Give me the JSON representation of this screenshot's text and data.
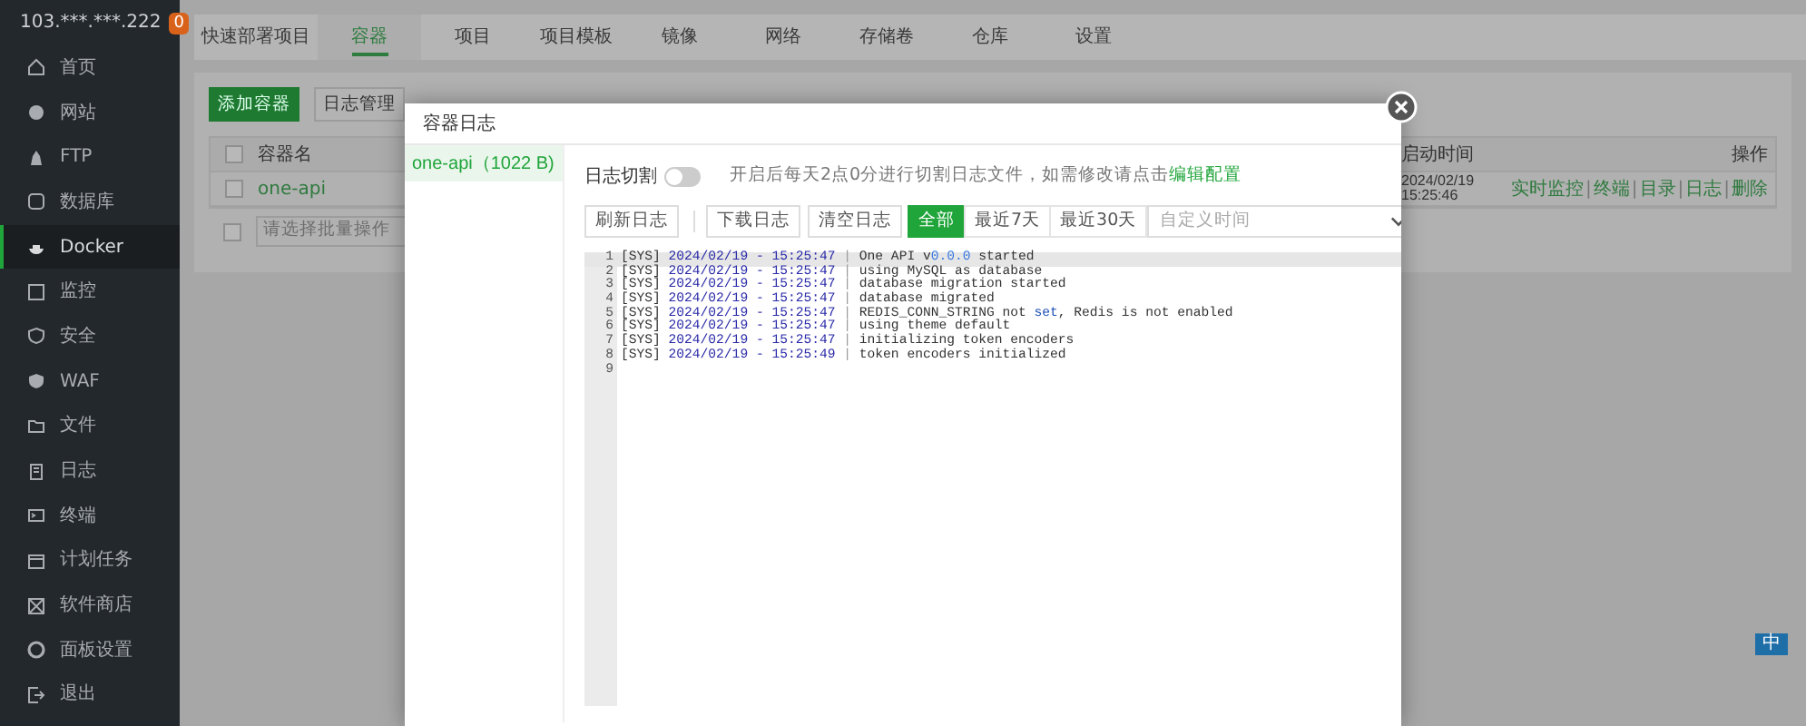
{
  "server": {
    "address": "103.***.***.222",
    "badge": "0"
  },
  "sidebar": {
    "items": [
      {
        "label": "首页",
        "selected": false
      },
      {
        "label": "网站",
        "selected": false
      },
      {
        "label": "FTP",
        "selected": false
      },
      {
        "label": "数据库",
        "selected": false
      },
      {
        "label": "Docker",
        "selected": true
      },
      {
        "label": "监控",
        "selected": false
      },
      {
        "label": "安全",
        "selected": false
      },
      {
        "label": "WAF",
        "selected": false
      },
      {
        "label": "文件",
        "selected": false
      },
      {
        "label": "日志",
        "selected": false
      },
      {
        "label": "终端",
        "selected": false
      },
      {
        "label": "计划任务",
        "selected": false
      },
      {
        "label": "软件商店",
        "selected": false
      },
      {
        "label": "面板设置",
        "selected": false
      },
      {
        "label": "退出",
        "selected": false
      }
    ]
  },
  "tabs": [
    {
      "label": "快速部署项目",
      "selected": false
    },
    {
      "label": "容器",
      "selected": true
    },
    {
      "label": "项目",
      "selected": false
    },
    {
      "label": "项目模板",
      "selected": false
    },
    {
      "label": "镜像",
      "selected": false
    },
    {
      "label": "网络",
      "selected": false
    },
    {
      "label": "存储卷",
      "selected": false
    },
    {
      "label": "仓库",
      "selected": false
    },
    {
      "label": "设置",
      "selected": false
    }
  ],
  "toolbar": {
    "buttons": [
      {
        "label": "添加容器",
        "kind": "primary"
      },
      {
        "label": "日志管理",
        "kind": "default"
      }
    ]
  },
  "table": {
    "header": {
      "select_all_checked": false,
      "name": "容器名",
      "start_time": "启动时间",
      "actions": "操作"
    },
    "rows": [
      {
        "checked": false,
        "name": "one-api",
        "start_time": "2024/02/19 15:25:46",
        "actions": [
          "实时监控",
          "终端",
          "目录",
          "日志",
          "删除"
        ],
        "separators": [
          "|",
          "|",
          "|",
          "|"
        ]
      }
    ],
    "bulk": {
      "checked": false,
      "placeholder": "请选择批量操作"
    }
  },
  "modal": {
    "title": "容器日志",
    "containers": [
      {
        "label": "one-api（1022 B)",
        "selected": true
      }
    ],
    "rotation": {
      "label": "日志切割",
      "on": false,
      "notice": "开启后每天2点0分进行切割日志文件，如需修改请点击",
      "link": "编辑配置"
    },
    "action_groups": [
      [
        "刷新日志"
      ],
      [
        "下载日志",
        "清空日志"
      ]
    ],
    "ranges": [
      {
        "label": "全部",
        "selected": true
      },
      {
        "label": "最近7天",
        "selected": false
      },
      {
        "label": "最近30天",
        "selected": false
      }
    ],
    "date_picker": {
      "placeholder": "自定义时间"
    },
    "log": {
      "lines": [
        {
          "number": "1",
          "highlighted": true,
          "tag": "[SYS]",
          "timestamp": "2024/02/19 - 15:25:47",
          "divider": "|",
          "message": [
            {
              "text": "One API v"
            },
            {
              "text": "0.0.0",
              "kind": "number"
            },
            {
              "text": " started"
            }
          ]
        },
        {
          "number": "2",
          "highlighted": false,
          "tag": "[SYS]",
          "timestamp": "2024/02/19 - 15:25:47",
          "divider": "|",
          "message": [
            {
              "text": "using MySQL as database"
            }
          ]
        },
        {
          "number": "3",
          "highlighted": false,
          "tag": "[SYS]",
          "timestamp": "2024/02/19 - 15:25:47",
          "divider": "|",
          "message": [
            {
              "text": "database migration started"
            }
          ]
        },
        {
          "number": "4",
          "highlighted": false,
          "tag": "[SYS]",
          "timestamp": "2024/02/19 - 15:25:47",
          "divider": "|",
          "message": [
            {
              "text": "database migrated"
            }
          ]
        },
        {
          "number": "5",
          "highlighted": false,
          "tag": "[SYS]",
          "timestamp": "2024/02/19 - 15:25:47",
          "divider": "|",
          "message": [
            {
              "text": "REDIS_CONN_STRING not "
            },
            {
              "text": "set",
              "kind": "keyword"
            },
            {
              "text": ", Redis is not enabled"
            }
          ]
        },
        {
          "number": "6",
          "highlighted": false,
          "tag": "[SYS]",
          "timestamp": "2024/02/19 - 15:25:47",
          "divider": "|",
          "message": [
            {
              "text": "using theme default"
            }
          ]
        },
        {
          "number": "7",
          "highlighted": false,
          "tag": "[SYS]",
          "timestamp": "2024/02/19 - 15:25:47",
          "divider": "|",
          "message": [
            {
              "text": "initializing token encoders"
            }
          ]
        },
        {
          "number": "8",
          "highlighted": false,
          "tag": "[SYS]",
          "timestamp": "2024/02/19 - 15:25:49",
          "divider": "|",
          "message": [
            {
              "text": "token encoders initialized"
            }
          ]
        },
        {
          "number": "9",
          "highlighted": false
        }
      ]
    }
  },
  "ime": {
    "label": "中"
  }
}
